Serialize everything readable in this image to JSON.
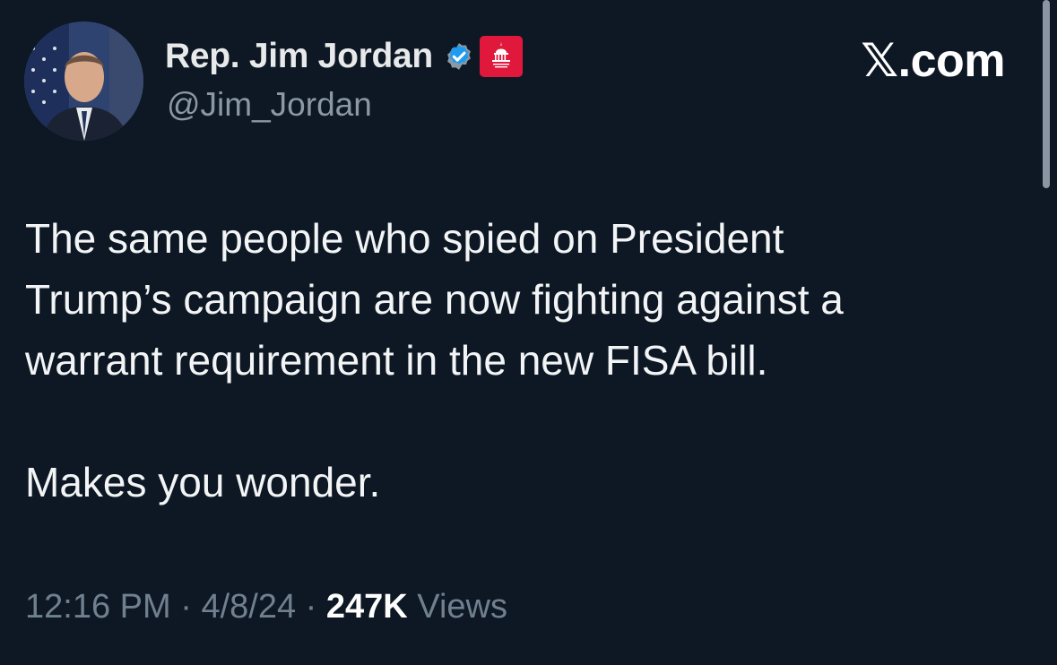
{
  "author": {
    "display_name": "Rep. Jim Jordan",
    "handle": "@Jim_Jordan",
    "verified_icon": "verified-check-icon",
    "affiliation_badge_icon": "capitol-gop-badge-icon",
    "verified_color": "#1d9bf0",
    "badge_color": "#e0193c"
  },
  "brand": {
    "label": "𝕏.com"
  },
  "tweet": {
    "lines": [
      "The same people who spied on President",
      "Trump’s campaign are now fighting against a",
      "warrant requirement in the new FISA bill."
    ],
    "closing": "Makes you wonder."
  },
  "meta": {
    "time": "12:16 PM",
    "separator": "·",
    "date": "4/8/24",
    "views_count": "247K",
    "views_label": "Views"
  },
  "colors": {
    "background": "#0d1824",
    "text_primary": "#e7e9ea",
    "text_secondary": "#8b98a5"
  }
}
